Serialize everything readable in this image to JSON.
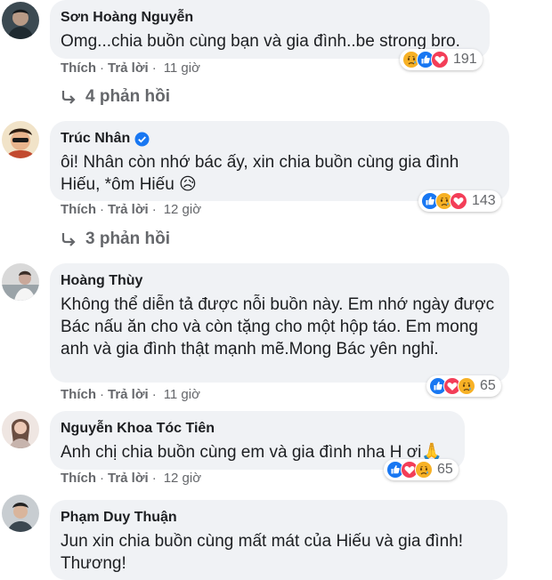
{
  "actions": {
    "like": "Thích",
    "reply": "Trả lời",
    "separator": "·"
  },
  "comments": [
    {
      "author": "Sơn Hoàng Nguyễn",
      "text": "Omg...chia buồn cùng bạn và gia đình..be strong bro.",
      "time": "11 giờ",
      "reaction_count": "191",
      "reactions": [
        "sad-reaction-icon",
        "like-reaction-icon",
        "love-reaction-icon"
      ],
      "replies": "4 phản hồi"
    },
    {
      "author": "Trúc Nhân",
      "verified": true,
      "text": "ôi! Nhân còn nhớ bác ấy, xin chia buồn cùng gia đình Hiếu, *ôm Hiếu 😥",
      "time": "12 giờ",
      "reaction_count": "143",
      "reactions": [
        "like-reaction-icon",
        "sad-reaction-icon",
        "love-reaction-icon"
      ],
      "replies": "3 phản hồi"
    },
    {
      "author": "Hoàng Thùy",
      "text": "Không thể diễn tả được nỗi buồn này. Em nhớ ngày được Bác nấu ăn cho và còn tặng cho một hộp táo. Em mong anh và gia đình thật mạnh mẽ.Mong Bác yên nghỉ.",
      "time": "11 giờ",
      "reaction_count": "65",
      "reactions": [
        "like-reaction-icon",
        "love-reaction-icon",
        "sad-reaction-icon"
      ]
    },
    {
      "author": "Nguyễn Khoa Tóc Tiên",
      "text": "Anh chị chia buồn cùng em và gia đình nha H ơi🙏",
      "time": "12 giờ",
      "reaction_count": "65",
      "reactions": [
        "like-reaction-icon",
        "love-reaction-icon",
        "sad-reaction-icon"
      ]
    },
    {
      "author": "Phạm Duy Thuận",
      "text": "Jun xin chia buồn cùng mất mát của Hiếu và gia đình! Thương!"
    }
  ],
  "colors": {
    "bubble": "#f0f2f5",
    "secondary_text": "#65676b",
    "like_blue": "#1877f2",
    "love_red": "#f33e58",
    "sad_yellow": "#f7b125"
  }
}
